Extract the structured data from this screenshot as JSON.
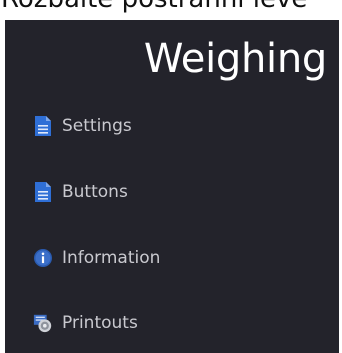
{
  "top_caption": "Rozbalte postranní levé",
  "panel": {
    "title": "Weighing",
    "items": [
      {
        "label": "Settings",
        "icon": "document-icon"
      },
      {
        "label": "Buttons",
        "icon": "document-icon"
      },
      {
        "label": "Information",
        "icon": "info-icon"
      },
      {
        "label": "Printouts",
        "icon": "printer-icon"
      }
    ]
  },
  "colors": {
    "panel_bg": "#23232b",
    "title": "#ffffff",
    "label": "#c9c9cf",
    "icon_blue": "#2f6fd6"
  }
}
